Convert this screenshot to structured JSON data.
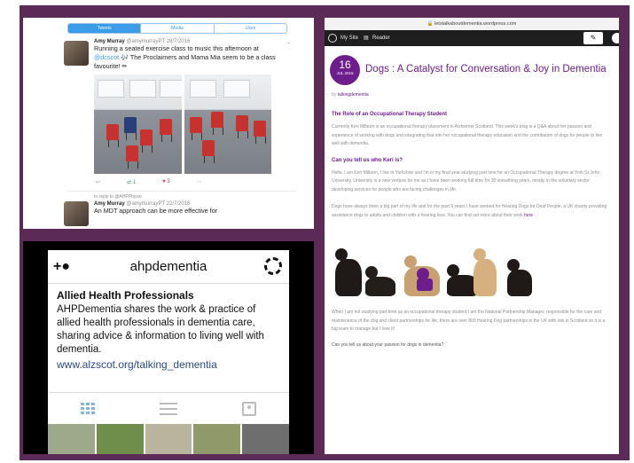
{
  "twitter": {
    "tabs": [
      "Tweets",
      "Media",
      "Likes"
    ],
    "tweet1": {
      "name": "Amy Murray",
      "handle": "@amymurrayPT",
      "date": "28/7/2016",
      "text_before": "Running a seated exercise class to music this afternoon at",
      "mention": "@dcscot",
      "text_after": "The Proclaimers and Mama Mia seem to be a class favourite!",
      "retweets": "1",
      "likes": "3"
    },
    "reply_note": "In reply to @AHPPhysio",
    "tweet2": {
      "name": "Amy Murray",
      "handle": "@amymurrayPT",
      "date": "22/7/2016",
      "text": "An MDT approach can be more effective for"
    }
  },
  "instagram": {
    "username": "ahpdementia",
    "name": "Allied Health Professionals",
    "bio": "AHPDementia shares the work & practice of allied health professionals in dementia care, sharing advice & information to living well with dementia.",
    "link": "www.alzscot.org/talking_dementia",
    "thumb_colors": [
      "#9ea88a",
      "#6f8d4b",
      "#b9b49e",
      "#8f9a68",
      "#6e6e6e"
    ]
  },
  "blog": {
    "url": "letstalkaboutdementia.wordpress.com",
    "bar": {
      "my_site": "My Site",
      "reader": "Reader"
    },
    "date_day": "16",
    "date_month": "JUL 2016",
    "title": "Dogs : A Catalyst for Conversation & Joy in Dementia",
    "by_prefix": "by",
    "author": "talkingdementia",
    "heading1": "The Role of an Occupational Therapy Student",
    "para1": "Currently Keri Milburn is an occupational therapy placement in Alzheimer Scotland. This week's blog is a Q&A about her passion and experience of working with dogs and integrating that into her occupational therapy education and the contribution of dogs for people to live well with dementia.",
    "heading2": "Can you tell us who Keri is?",
    "para2": "Hello, I am Keri Milburn, I live in Yorkshire and I'm in my final year studying part time for an Occupational Therapy degree at York St John University. University is a new venture for me as I have been working full time for 30 something years, mostly in the voluntary sector developing services for people who are facing challenges in life.",
    "para3": "Dogs have always been a big part of my life and for the past 9 years I have worked for Hearing Dogs for Deaf People, a UK charity providing assistance dogs to adults and children with a hearing loss. You can find out more about their work",
    "para3_link": "here",
    "para4": "When I am not studying part time as an occupational therapy student I am the National Partnership Manager, responsible for the care and maintenance of the dog and client partnerships for life, there are over 800 Hearing Dog partnerships in the UK with lots in Scotland so it is a big team to manage but I love it!",
    "para5": "Can you tell us about your passion for dogs in dementia?"
  },
  "colors": {
    "frame": "#5c2a57",
    "twitter_blue": "#3a9be6",
    "blog_purple": "#6e1d8c",
    "ig_link": "#2b4a86"
  }
}
